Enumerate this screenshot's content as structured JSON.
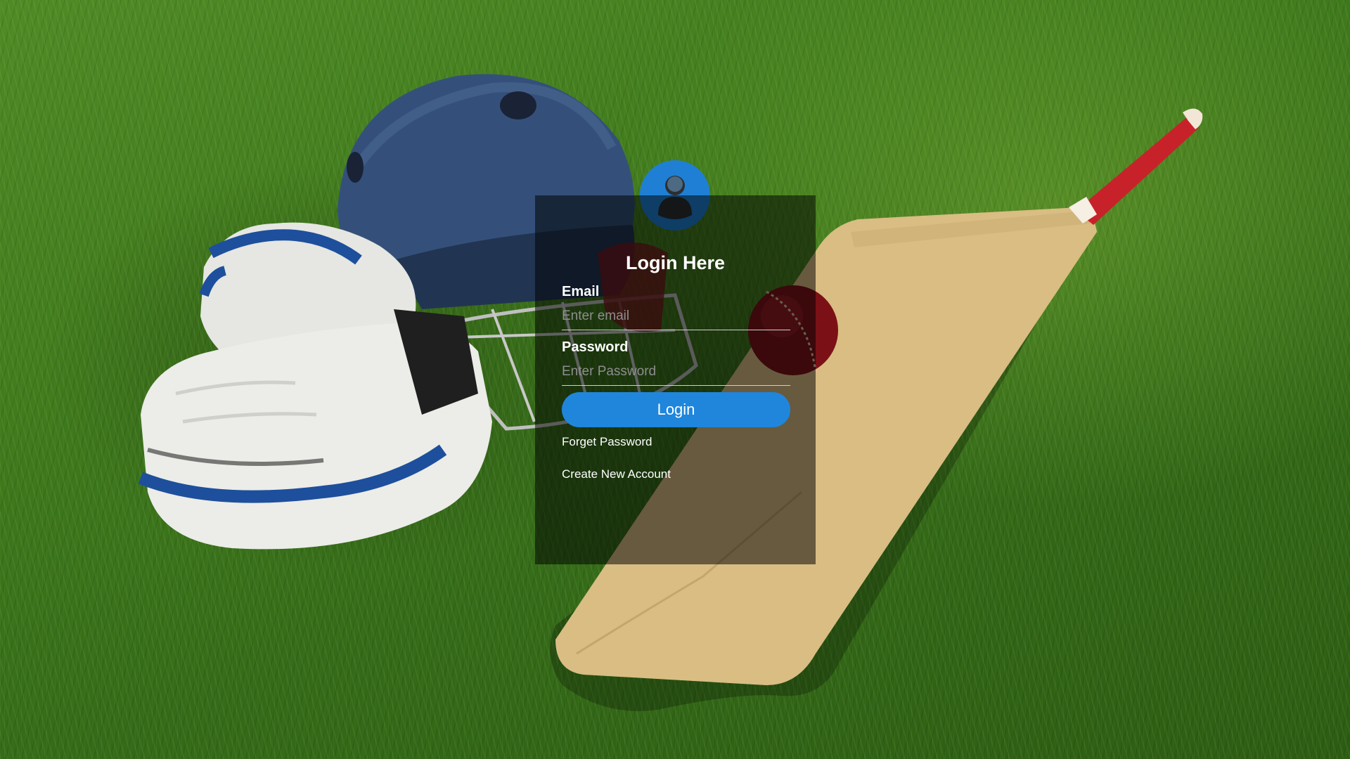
{
  "login": {
    "title": "Login Here",
    "email_label": "Email",
    "email_placeholder": "Enter email",
    "email_value": "",
    "password_label": "Password",
    "password_placeholder": "Enter Password",
    "password_value": "",
    "button_label": "Login",
    "forget_link": "Forget Password",
    "create_link": "Create New Account",
    "avatar_icon": "user-icon"
  },
  "theme": {
    "accent": "#1f86dc",
    "avatar_bg": "#1f7fd4",
    "card_bg": "rgba(0,0,0,0.52)",
    "text": "#ffffff"
  },
  "background": {
    "subject": "cricket gear on grass"
  }
}
